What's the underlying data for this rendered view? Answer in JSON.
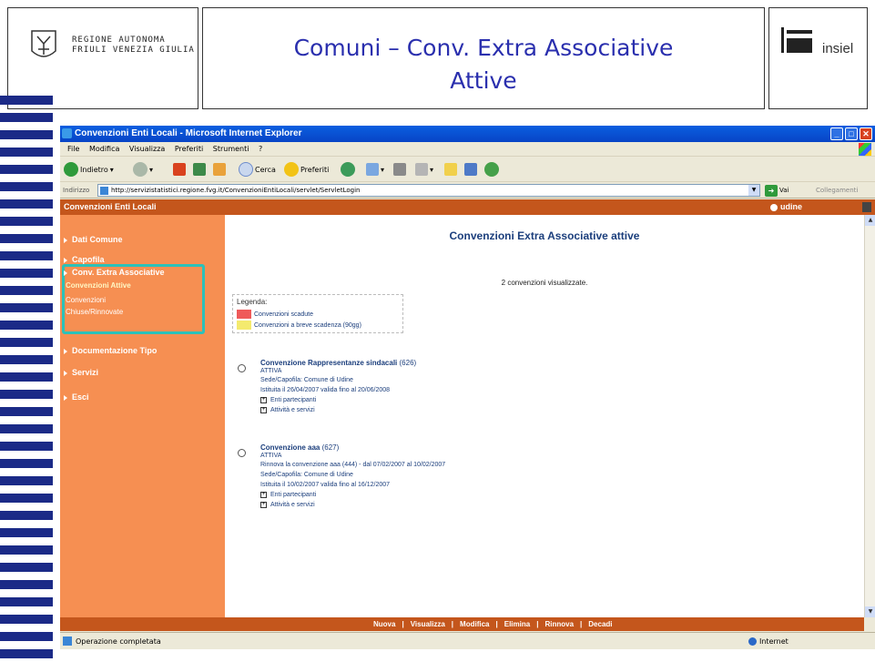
{
  "slide": {
    "region": [
      "REGIONE AUTONOMA",
      "FRIULI VENEZIA GIULIA"
    ],
    "title_line1": "Comuni – Conv. Extra Associative",
    "title_line2": "Attive",
    "company": "insiel",
    "colors": {
      "title": "#2a2fae",
      "stripes": "#1b2a87"
    }
  },
  "browser": {
    "window_title": "Convenzioni Enti Locali - Microsoft Internet Explorer",
    "menu": [
      "File",
      "Modifica",
      "Visualizza",
      "Preferiti",
      "Strumenti",
      "?"
    ],
    "toolbar": {
      "back": "Indietro",
      "search": "Cerca",
      "favorites": "Preferiti"
    },
    "address_label": "Indirizzo",
    "address_value": "http://servizistatistici.regione.fvg.it/ConvenzioniEntiLocali/servlet/ServletLogin",
    "go_label": "Vai",
    "links_label": "Collegamenti",
    "status_text": "Operazione completata",
    "zone": "Internet"
  },
  "app": {
    "header_title": "Convenzioni Enti Locali",
    "user": "udine",
    "colors": {
      "header": "#c4561c",
      "sidebar": "#f68f52",
      "highlight": "#2cc1b9",
      "link": "#1b3e7c"
    },
    "nav": {
      "dati_comune": "Dati Comune",
      "capofila": "Capofila",
      "conv_extra": "Conv. Extra Associative",
      "sub_attive": "Convenzioni Attive",
      "sub_chiuse_1": "Convenzioni",
      "sub_chiuse_2": "Chiuse/Rinnovate",
      "documentazione": "Documentazione Tipo",
      "servizi": "Servizi",
      "esci": "Esci"
    },
    "page_title": "Convenzioni Extra Associative attive",
    "count_text": "2 convenzioni visualizzate.",
    "legend": {
      "title": "Legenda:",
      "items": [
        {
          "label": "Convenzioni scadute",
          "color": "#ef5a5a"
        },
        {
          "label": "Convenzioni a breve scadenza (90gg)",
          "color": "#f4ea6e"
        }
      ]
    },
    "conventions": [
      {
        "title": "Convenzione Rappresentanze sindacali",
        "number": "(626)",
        "status": "ATTIVA",
        "renewal": "",
        "sede": "Sede/Capofila: Comune di Udine",
        "dates": "Istituita il 26/04/2007 valida fino al 20/06/2008",
        "link1": "Enti partecipanti",
        "link2": "Attività e servizi"
      },
      {
        "title": "Convenzione aaa",
        "number": "(627)",
        "status": "ATTIVA",
        "renewal": "Rinnova la convenzione aaa (444) - dal 07/02/2007 al 10/02/2007",
        "sede": "Sede/Capofila: Comune di Udine",
        "dates": "Istituita il 10/02/2007 valida fino al 16/12/2007",
        "link1": "Enti partecipanti",
        "link2": "Attività e servizi"
      }
    ],
    "footer": [
      "Nuova",
      "Visualizza",
      "Modifica",
      "Elimina",
      "Rinnova",
      "Decadi"
    ]
  }
}
